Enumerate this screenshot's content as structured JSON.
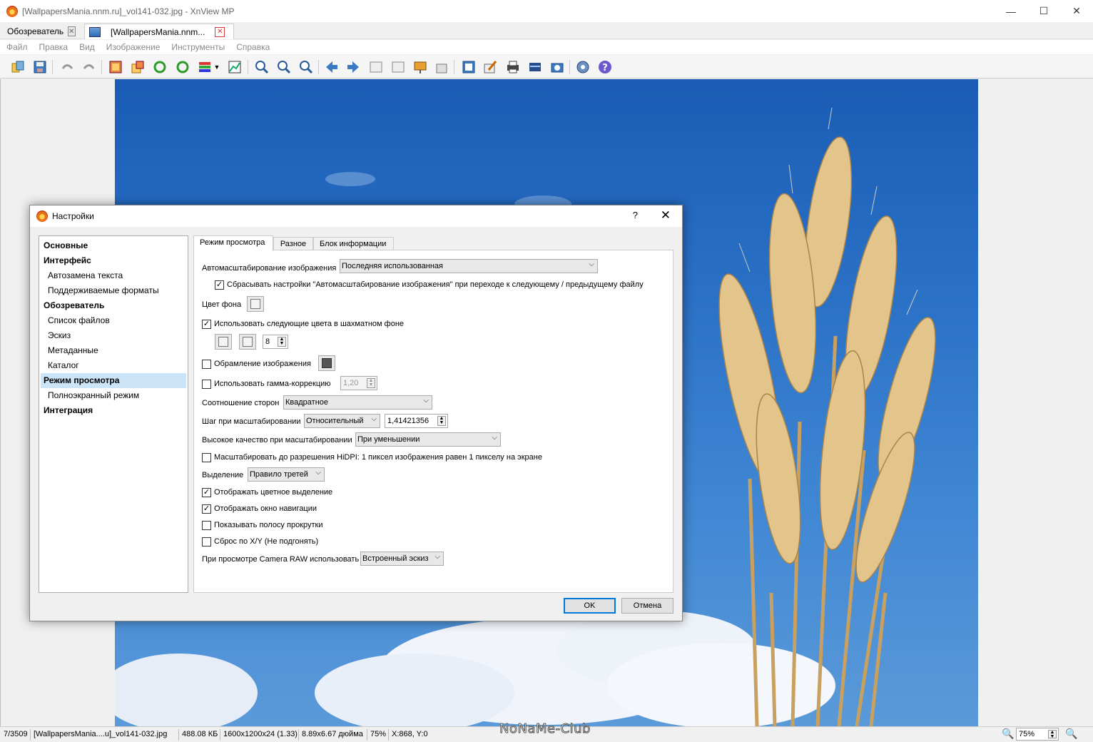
{
  "window": {
    "title": "[WallpapersMania.nnm.ru]_vol141-032.jpg - XnView MP",
    "controls": {
      "minimize": "—",
      "maximize": "☐",
      "close": "✕"
    }
  },
  "tabs": [
    {
      "label": "Обозреватель"
    },
    {
      "label": "[WallpapersMania.nnm..."
    }
  ],
  "menu": [
    "Файл",
    "Правка",
    "Вид",
    "Изображение",
    "Инструменты",
    "Справка"
  ],
  "toolbar_icons": [
    "open-icon",
    "save-icon",
    "undo-icon",
    "redo-icon",
    "crop-icon",
    "resize-icon",
    "rotate-left-icon",
    "rotate-right-icon",
    "adjust-colors-icon",
    "dropdown-arrow-icon",
    "levels-icon",
    "zoom-in-icon",
    "zoom-fit-icon",
    "zoom-out-icon",
    "previous-icon",
    "next-icon",
    "first-icon",
    "last-icon",
    "slideshow-icon",
    "compare-icon",
    "fullscreen-icon",
    "edit-icon",
    "print-icon",
    "scanner-icon",
    "camera-icon",
    "settings-icon",
    "help-icon"
  ],
  "dialog": {
    "title": "Настройки",
    "help": "?",
    "close": "✕",
    "nav": [
      {
        "label": "Основные",
        "level": 0
      },
      {
        "label": "Интерфейс",
        "level": 0
      },
      {
        "label": "Автозамена текста",
        "level": 1
      },
      {
        "label": "Поддерживаемые форматы",
        "level": 1
      },
      {
        "label": "Обозреватель",
        "level": 0
      },
      {
        "label": "Список файлов",
        "level": 1
      },
      {
        "label": "Эскиз",
        "level": 1
      },
      {
        "label": "Метаданные",
        "level": 1
      },
      {
        "label": "Каталог",
        "level": 1
      },
      {
        "label": "Режим просмотра",
        "level": 0,
        "selected": true
      },
      {
        "label": "Полноэкранный режим",
        "level": 1
      },
      {
        "label": "Интеграция",
        "level": 0
      }
    ],
    "tabs": [
      "Режим просмотра",
      "Разное",
      "Блок информации"
    ],
    "active_tab": "Режим просмотра",
    "settings": {
      "autoscale_label": "Автомасштабирование изображения",
      "autoscale_value": "Последняя использованная",
      "reset_autoscale_label": "Сбрасывать настройки \"Автомасштабирование изображения\" при переходе к следующему / предыдущему файлу",
      "reset_autoscale_checked": true,
      "bg_color_label": "Цвет фона",
      "checker_label": "Использовать следующие цвета в шахматном фоне",
      "checker_checked": true,
      "checker_size": "8",
      "frame_label": "Обрамление изображения",
      "frame_checked": false,
      "gamma_label": "Использовать гамма-коррекцию",
      "gamma_checked": false,
      "gamma_value": "1,20",
      "aspect_label": "Соотношение сторон",
      "aspect_value": "Квадратное",
      "zoom_step_label": "Шаг при масштабировании",
      "zoom_step_mode": "Относительный",
      "zoom_step_value": "1,41421356",
      "hq_label": "Высокое качество при масштабировании",
      "hq_value": "При уменьшении",
      "hidpi_label": "Масштабировать до разрешения HiDPI: 1 пиксел изображения равен 1 пикселу на экране",
      "hidpi_checked": false,
      "selection_label": "Выделение",
      "selection_value": "Правило третей",
      "color_selection_label": "Отображать цветное выделение",
      "color_selection_checked": true,
      "nav_window_label": "Отображать окно навигации",
      "nav_window_checked": true,
      "scrollbar_label": "Показывать полосу прокрутки",
      "scrollbar_checked": false,
      "reset_xy_label": "Сброс по X/Y (Не подгонять)",
      "reset_xy_checked": false,
      "raw_label": "При просмотре Camera RAW использовать",
      "raw_value": "Встроенный эскиз"
    },
    "buttons": {
      "ok": "OK",
      "cancel": "Отмена"
    }
  },
  "status": {
    "index": "7/3509",
    "filename": "[WallpapersMania....u]_vol141-032.jpg",
    "filesize": "488.08 КБ",
    "dimensions": "1600x1200x24 (1.33)",
    "print_size": "8.89x6.67 дюйма",
    "zoom": "75%",
    "coords": "X:868, Y:0",
    "zoom_field": "75%"
  },
  "watermark": "NoNaMe-Club"
}
